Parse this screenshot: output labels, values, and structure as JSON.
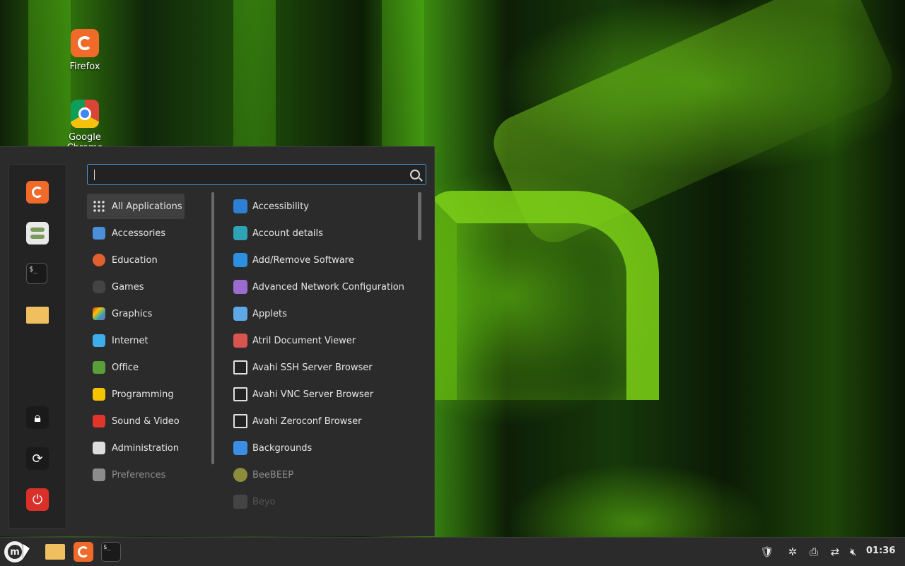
{
  "desktop": {
    "icons": [
      {
        "label": "Firefox"
      },
      {
        "label": "Google Chrome"
      }
    ]
  },
  "menu": {
    "search": {
      "value": "",
      "placeholder": ""
    },
    "sidebar": {
      "favorites": [
        "firefox-icon",
        "settings-icon",
        "terminal-icon",
        "folder-icon"
      ],
      "system": [
        "lock-icon",
        "logout-icon",
        "power-icon"
      ]
    },
    "categories": [
      {
        "label": "All Applications",
        "icon": "grid-icon",
        "color": "#2b2b2b"
      },
      {
        "label": "Accessories",
        "icon": "scissors-icon",
        "color": "#4a90d9"
      },
      {
        "label": "Education",
        "icon": "education-icon",
        "color": "#e06030"
      },
      {
        "label": "Games",
        "icon": "gamepad-icon",
        "color": "#444444"
      },
      {
        "label": "Graphics",
        "icon": "graphics-icon",
        "color": "#9b59b6"
      },
      {
        "label": "Internet",
        "icon": "cloud-icon",
        "color": "#3daee9"
      },
      {
        "label": "Office",
        "icon": "office-icon",
        "color": "#5a9e3a"
      },
      {
        "label": "Programming",
        "icon": "programming-icon",
        "color": "#f5c400"
      },
      {
        "label": "Sound & Video",
        "icon": "play-icon",
        "color": "#e0352b"
      },
      {
        "label": "Administration",
        "icon": "admin-icon",
        "color": "#dddddd"
      },
      {
        "label": "Preferences",
        "icon": "preferences-icon",
        "color": "#bbbbbb"
      }
    ],
    "apps": [
      {
        "label": "Accessibility",
        "icon": "accessibility-icon",
        "color": "#2d7fd3"
      },
      {
        "label": "Account details",
        "icon": "user-icon",
        "color": "#2ea3b5"
      },
      {
        "label": "Add/Remove Software",
        "icon": "download-icon",
        "color": "#2d8fe0"
      },
      {
        "label": "Advanced Network Configuration",
        "icon": "network-icon",
        "color": "#9c6bd0"
      },
      {
        "label": "Applets",
        "icon": "applets-icon",
        "color": "#5fa8e8"
      },
      {
        "label": "Atril Document Viewer",
        "icon": "glasses-icon",
        "color": "#d9534f"
      },
      {
        "label": "Avahi SSH Server Browser",
        "icon": "monitor-icon",
        "color": "#e0e0e0"
      },
      {
        "label": "Avahi VNC Server Browser",
        "icon": "monitor-icon",
        "color": "#e0e0e0"
      },
      {
        "label": "Avahi Zeroconf Browser",
        "icon": "monitor-icon",
        "color": "#e0e0e0"
      },
      {
        "label": "Backgrounds",
        "icon": "backgrounds-icon",
        "color": "#3a8ee6"
      },
      {
        "label": "BeeBEEP",
        "icon": "bee-icon",
        "color": "#8c8c3a"
      },
      {
        "label": "Beyo",
        "icon": "app-icon",
        "color": "#555555"
      }
    ]
  },
  "panel": {
    "tasks": [
      "folder-icon",
      "firefox-icon",
      "terminal-icon"
    ],
    "tray": [
      "shield-icon",
      "bee-icon",
      "printer-icon",
      "network-icon",
      "volume-mute-icon"
    ],
    "clock": "01:36"
  }
}
